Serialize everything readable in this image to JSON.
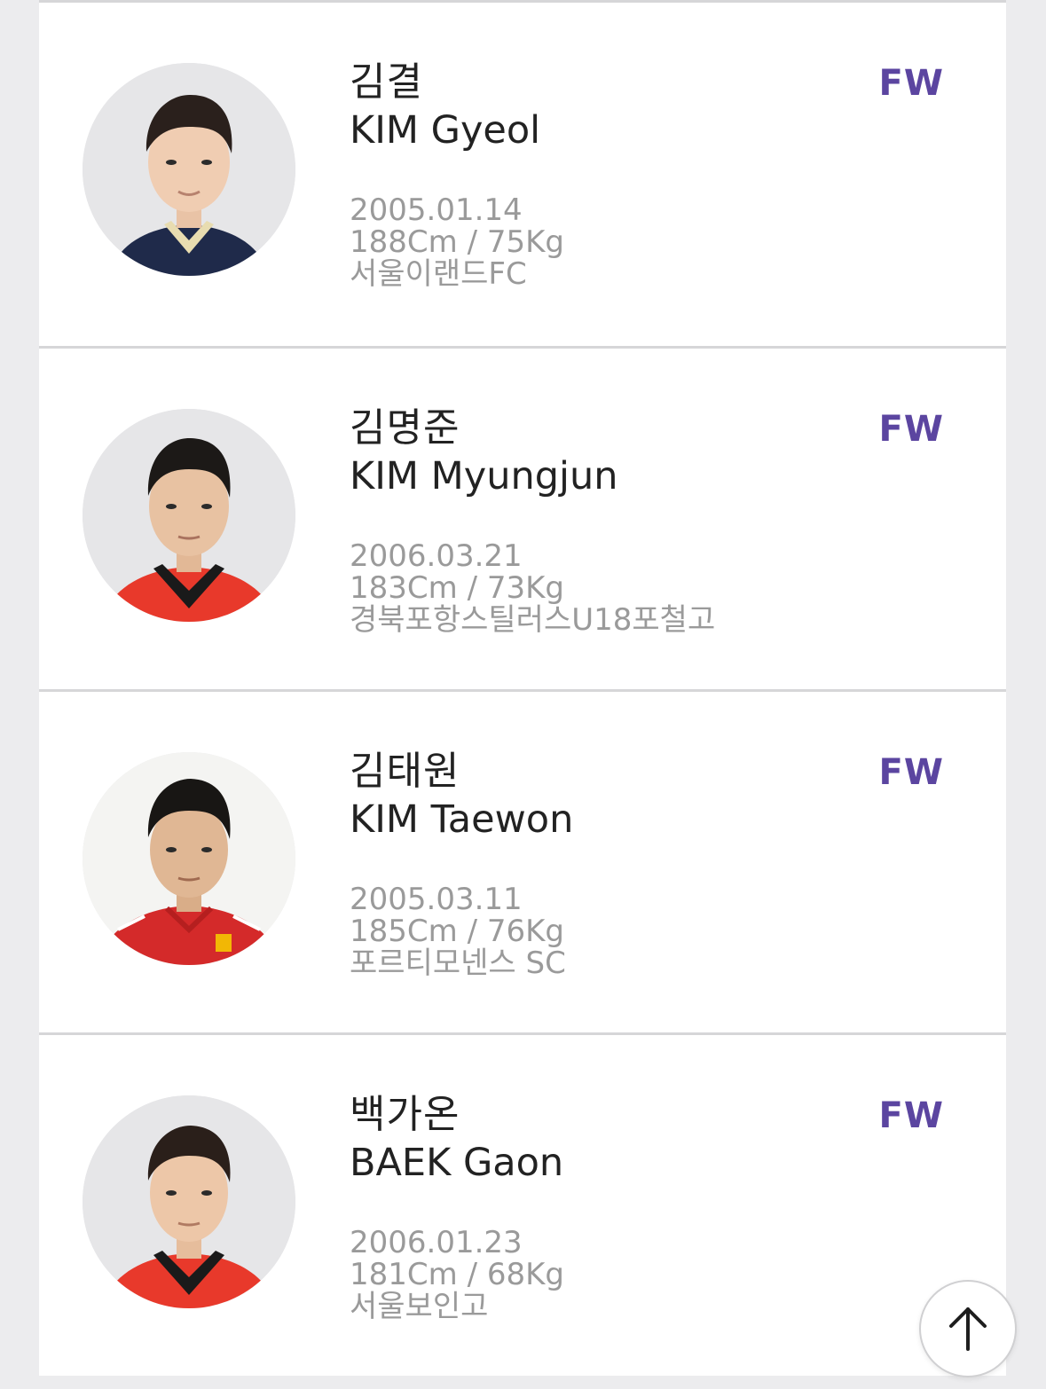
{
  "players": [
    {
      "name_ko": "김결",
      "name_en": "KIM Gyeol",
      "birth": "2005.01.14",
      "body": "188Cm / 75Kg",
      "club": "서울이랜드FC",
      "position": "FW",
      "jersey": "navy"
    },
    {
      "name_ko": "김명준",
      "name_en": "KIM Myungjun",
      "birth": "2006.03.21",
      "body": "183Cm / 73Kg",
      "club": "경북포항스틸러스U18포철고",
      "position": "FW",
      "jersey": "red"
    },
    {
      "name_ko": "김태원",
      "name_en": "KIM Taewon",
      "birth": "2005.03.11",
      "body": "185Cm / 76Kg",
      "club": "포르티모넨스 SC",
      "position": "FW",
      "jersey": "red-white-bg"
    },
    {
      "name_ko": "백가온",
      "name_en": "BAEK Gaon",
      "birth": "2006.01.23",
      "body": "181Cm / 68Kg",
      "club": "서울보인고",
      "position": "FW",
      "jersey": "red"
    }
  ],
  "scroll_top_button": {
    "icon": "arrow-up-icon"
  },
  "colors": {
    "position_accent": "#5b45a0",
    "name_text": "#222222",
    "meta_text": "#9a9a9a",
    "page_background": "#ececee",
    "card_background": "#ffffff"
  }
}
